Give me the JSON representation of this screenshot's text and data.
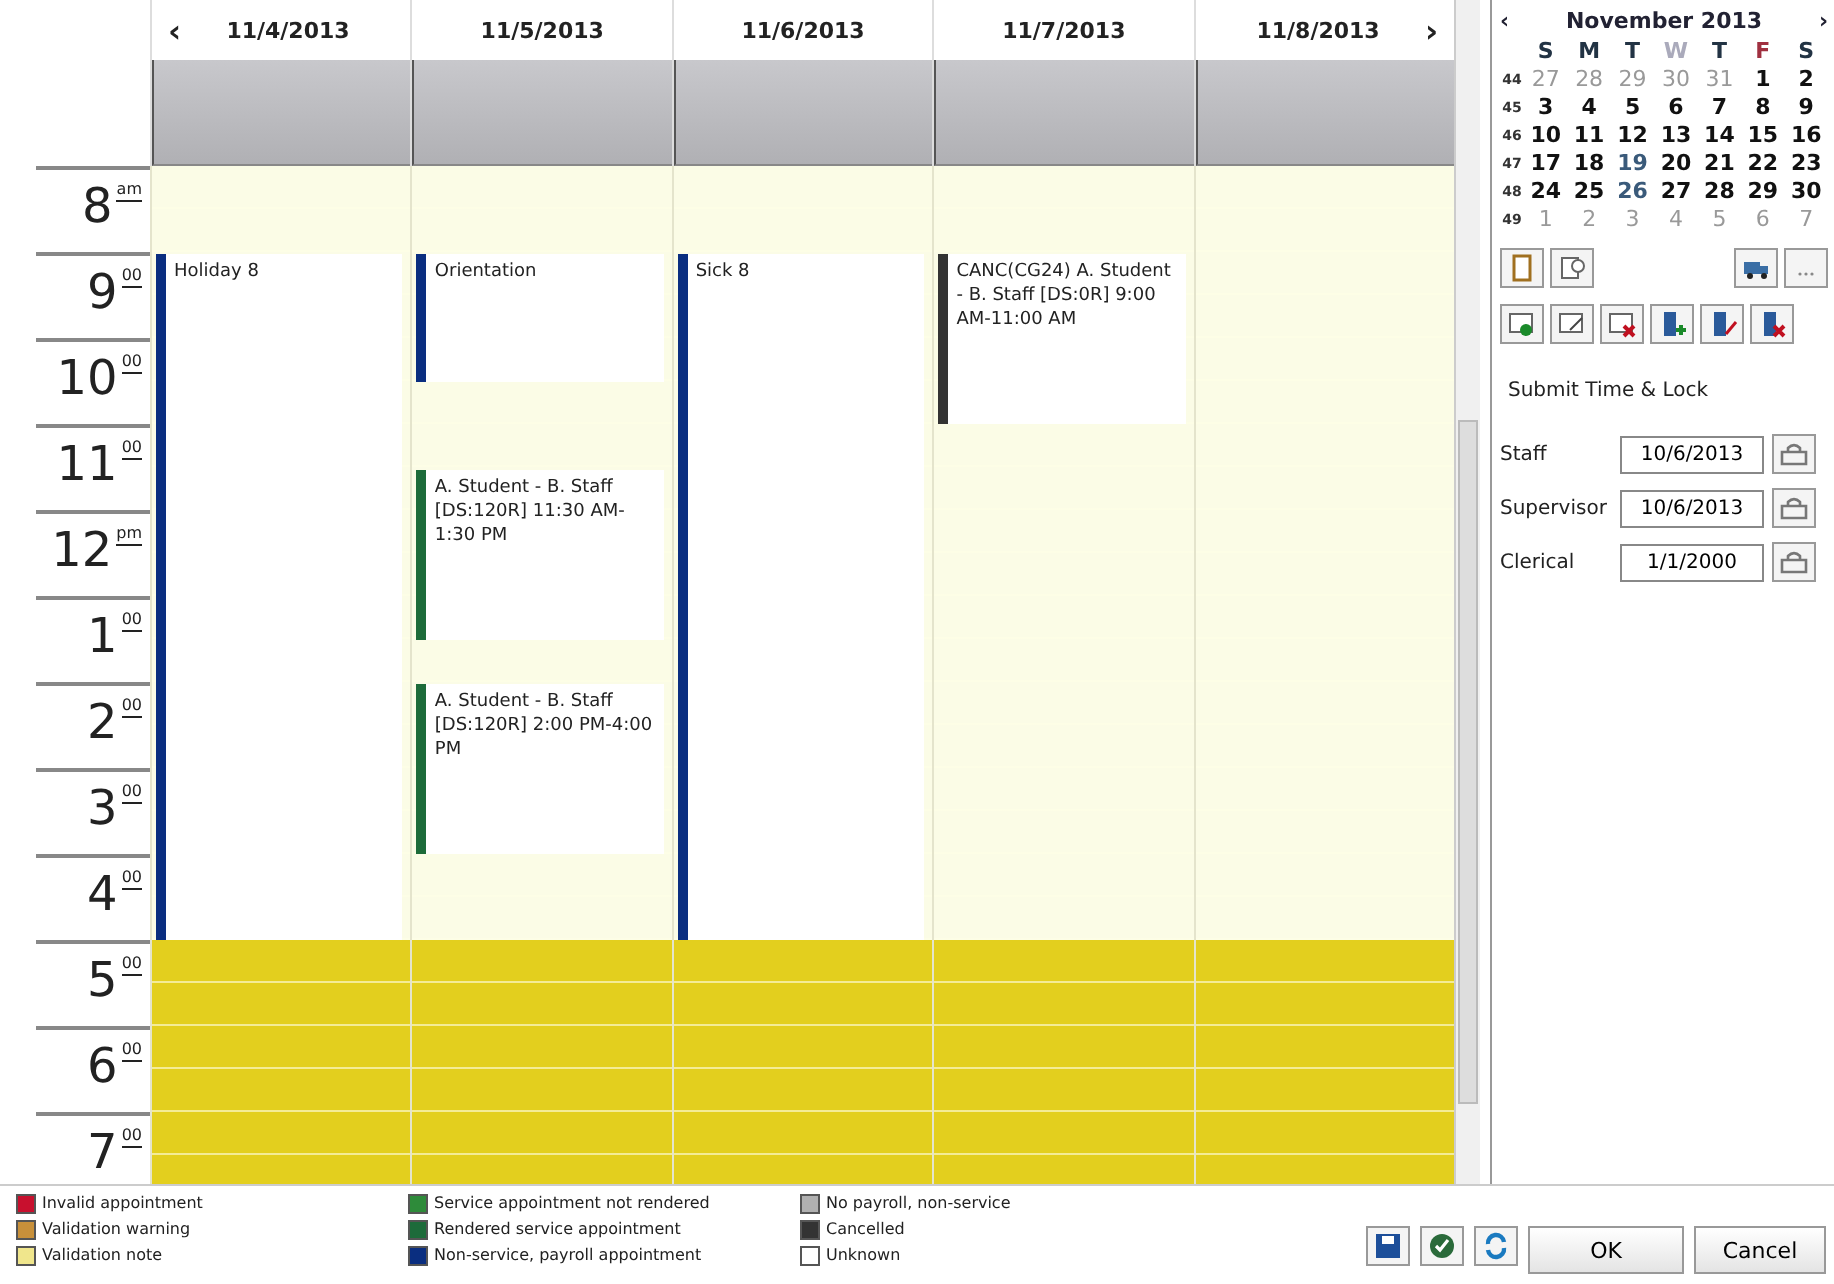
{
  "days": [
    {
      "label": "11/4/2013",
      "events": [
        {
          "text": "Holiday 8",
          "color": "#0a2e80"
        }
      ]
    },
    {
      "label": "11/5/2013",
      "events": [
        {
          "text": "Orientation",
          "color": "#0a2e80"
        },
        {
          "text": "A. Student - B. Staff [DS:120R] 11:30 AM-1:30 PM",
          "color": "#1d6b3a"
        },
        {
          "text": "A. Student - B. Staff [DS:120R] 2:00 PM-4:00 PM",
          "color": "#1d6b3a"
        }
      ]
    },
    {
      "label": "11/6/2013",
      "events": [
        {
          "text": "Sick 8",
          "color": "#0a2e80"
        }
      ]
    },
    {
      "label": "11/7/2013",
      "events": [
        {
          "text": "CANC(CG24) A. Student - B. Staff [DS:0R] 9:00 AM-11:00 AM",
          "color": "#333333"
        }
      ]
    },
    {
      "label": "11/8/2013"
    }
  ],
  "hours": [
    {
      "hour": "8",
      "suffix": "am"
    },
    {
      "hour": "9",
      "suffix": "00"
    },
    {
      "hour": "10",
      "suffix": "00"
    },
    {
      "hour": "11",
      "suffix": "00"
    },
    {
      "hour": "12",
      "suffix": "pm"
    },
    {
      "hour": "1",
      "suffix": "00"
    },
    {
      "hour": "2",
      "suffix": "00"
    },
    {
      "hour": "3",
      "suffix": "00"
    },
    {
      "hour": "4",
      "suffix": "00"
    },
    {
      "hour": "5",
      "suffix": "00",
      "after_hours": true
    },
    {
      "hour": "6",
      "suffix": "00",
      "after_hours": true
    },
    {
      "hour": "7",
      "suffix": "00",
      "after_hours": true
    }
  ],
  "nav": {
    "prev": "‹",
    "next": "›"
  },
  "mini_calendar": {
    "title": "November 2013",
    "prev": "‹",
    "next": "›",
    "weekdays": [
      {
        "label": "S",
        "kind": "normal"
      },
      {
        "label": "M",
        "kind": "normal"
      },
      {
        "label": "T",
        "kind": "normal"
      },
      {
        "label": "W",
        "kind": "muted"
      },
      {
        "label": "T",
        "kind": "normal"
      },
      {
        "label": "F",
        "kind": "red"
      },
      {
        "label": "S",
        "kind": "normal"
      }
    ],
    "weeks": [
      {
        "number": "44",
        "days": [
          {
            "d": "27",
            "other": true
          },
          {
            "d": "28",
            "other": true
          },
          {
            "d": "29",
            "other": true
          },
          {
            "d": "30",
            "other": true
          },
          {
            "d": "31",
            "other": true
          },
          {
            "d": "1",
            "other": false
          },
          {
            "d": "2",
            "other": false
          }
        ]
      },
      {
        "number": "45",
        "days": [
          {
            "d": "3",
            "other": false
          },
          {
            "d": "4",
            "other": false
          },
          {
            "d": "5",
            "other": false
          },
          {
            "d": "6",
            "other": false
          },
          {
            "d": "7",
            "other": false
          },
          {
            "d": "8",
            "other": false
          },
          {
            "d": "9",
            "other": false
          }
        ]
      },
      {
        "number": "46",
        "days": [
          {
            "d": "10",
            "other": false
          },
          {
            "d": "11",
            "other": false
          },
          {
            "d": "12",
            "other": false
          },
          {
            "d": "13",
            "other": false
          },
          {
            "d": "14",
            "other": false
          },
          {
            "d": "15",
            "other": false
          },
          {
            "d": "16",
            "other": false
          }
        ]
      },
      {
        "number": "47",
        "days": [
          {
            "d": "17",
            "other": false
          },
          {
            "d": "18",
            "other": false
          },
          {
            "d": "19",
            "other": false,
            "marked": true
          },
          {
            "d": "20",
            "other": false
          },
          {
            "d": "21",
            "other": false
          },
          {
            "d": "22",
            "other": false
          },
          {
            "d": "23",
            "other": false
          }
        ]
      },
      {
        "number": "48",
        "days": [
          {
            "d": "24",
            "other": false
          },
          {
            "d": "25",
            "other": false
          },
          {
            "d": "26",
            "other": false,
            "marked": true
          },
          {
            "d": "27",
            "other": false
          },
          {
            "d": "28",
            "other": false
          },
          {
            "d": "29",
            "other": false
          },
          {
            "d": "30",
            "other": false
          }
        ]
      },
      {
        "number": "49",
        "days": [
          {
            "d": "1",
            "other": true
          },
          {
            "d": "2",
            "other": true
          },
          {
            "d": "3",
            "other": true
          },
          {
            "d": "4",
            "other": true
          },
          {
            "d": "5",
            "other": true
          },
          {
            "d": "6",
            "other": true
          },
          {
            "d": "7",
            "other": true
          }
        ]
      }
    ]
  },
  "lock": {
    "title": "Submit Time & Lock",
    "fields": [
      {
        "label": "Staff",
        "value": "10/6/2013"
      },
      {
        "label": "Supervisor",
        "value": "10/6/2013"
      },
      {
        "label": "Clerical",
        "value": "1/1/2000"
      }
    ]
  },
  "legend": [
    {
      "label": "Invalid appointment",
      "color": "#c8102e"
    },
    {
      "label": "Validation warning",
      "color": "#c8903a"
    },
    {
      "label": "Validation note",
      "color": "#f0e68c"
    },
    {
      "label": "Service appointment not rendered",
      "color": "#2e8b3a"
    },
    {
      "label": "Rendered service appointment",
      "color": "#1d6b3a"
    },
    {
      "label": "Non-service, payroll appointment",
      "color": "#0a2e80"
    },
    {
      "label": "No payroll, non-service",
      "color": "#b0b0b0"
    },
    {
      "label": "Cancelled",
      "color": "#333333"
    },
    {
      "label": "Unknown",
      "color": "#ffffff"
    }
  ],
  "buttons": [
    {
      "label": "OK"
    },
    {
      "label": "Cancel"
    }
  ]
}
